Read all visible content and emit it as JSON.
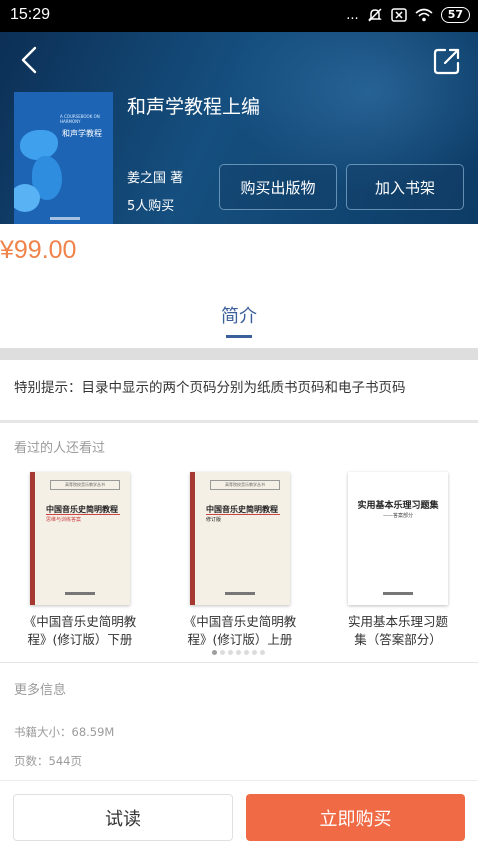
{
  "status_bar": {
    "time": "15:29",
    "dots": "...",
    "battery": "57"
  },
  "header": {
    "book_title": "和声学教程上编",
    "author": "姜之国 著",
    "buyers": "5人购买",
    "buy_print_label": "购买出版物",
    "add_shelf_label": "加入书架",
    "cover_title": "和声学教程",
    "cover_english": "A COURSEBOOK ON HARMONY"
  },
  "price": "¥99.00",
  "tabs": {
    "intro": "简介"
  },
  "notice": "特别提示：目录中显示的两个页码分别为纸质书页码和电子书页码",
  "recommendations": {
    "label": "看过的人还看过",
    "items": [
      {
        "caption_line1": "《中国音乐史简明教",
        "caption_line2": "程》(修订版）下册",
        "cover_title": "中国音乐史简明教程",
        "cover_sub": "思维与训练答案",
        "cover_series": "高等院校音乐教学丛书"
      },
      {
        "caption_line1": "《中国音乐史简明教",
        "caption_line2": "程》(修订版）上册",
        "cover_title": "中国音乐史简明教程",
        "cover_sub": "修订版",
        "cover_series": "高等院校音乐教学丛书"
      },
      {
        "caption_line1": "实用基本乐理习题",
        "caption_line2": "集（答案部分）",
        "cover_title": "实用基本乐理习题集",
        "cover_sub": "——答案部分"
      }
    ]
  },
  "more_info": {
    "label": "更多信息",
    "size": "书籍大小：68.59M",
    "pages": "页数：544页"
  },
  "bottom": {
    "try_label": "试读",
    "buy_now_label": "立即购买"
  },
  "colors": {
    "accent": "#f06a45",
    "price": "#f0834a",
    "tab": "#3b5f9a",
    "header": "#154f7f"
  }
}
